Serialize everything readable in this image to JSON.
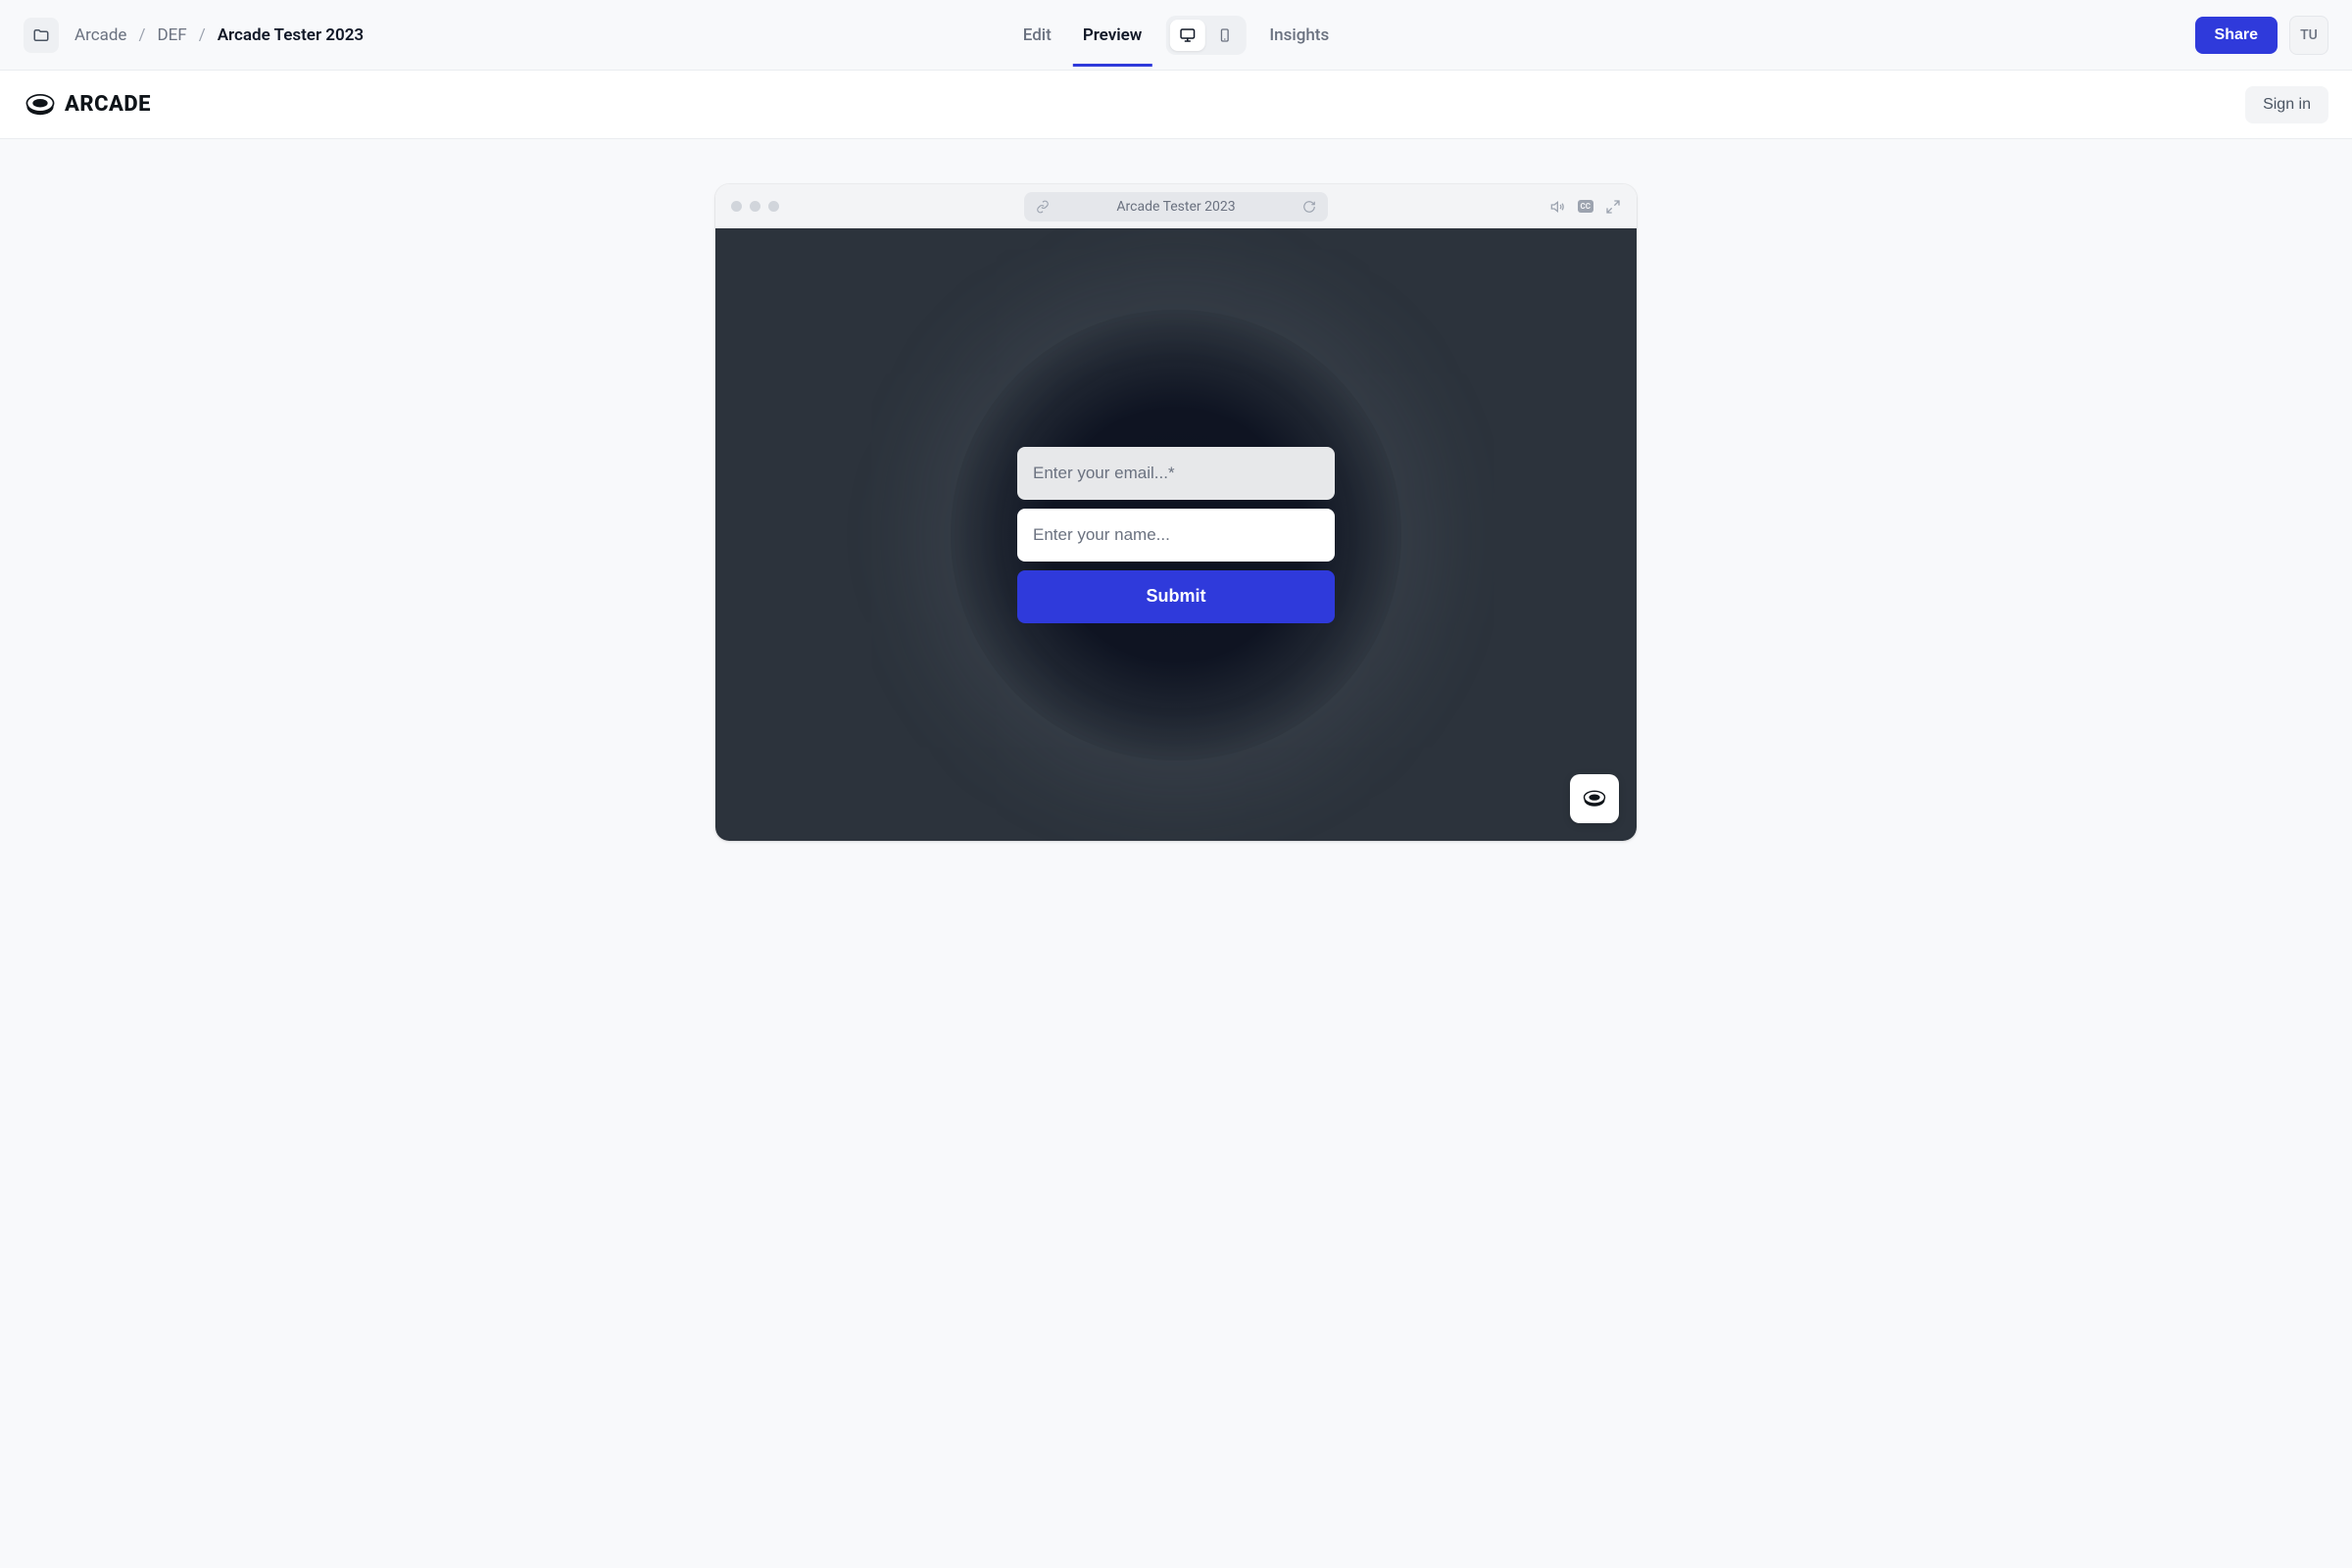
{
  "breadcrumb": {
    "root": "Arcade",
    "folder": "DEF",
    "current": "Arcade Tester 2023"
  },
  "nav": {
    "edit": "Edit",
    "preview": "Preview",
    "insights": "Insights"
  },
  "header": {
    "share_label": "Share",
    "avatar_initials": "TU"
  },
  "brand": {
    "name": "ARCADE",
    "signin_label": "Sign in"
  },
  "browser": {
    "title": "Arcade Tester 2023"
  },
  "form": {
    "email_placeholder": "Enter your email...*",
    "name_placeholder": "Enter your name...",
    "submit_label": "Submit"
  }
}
